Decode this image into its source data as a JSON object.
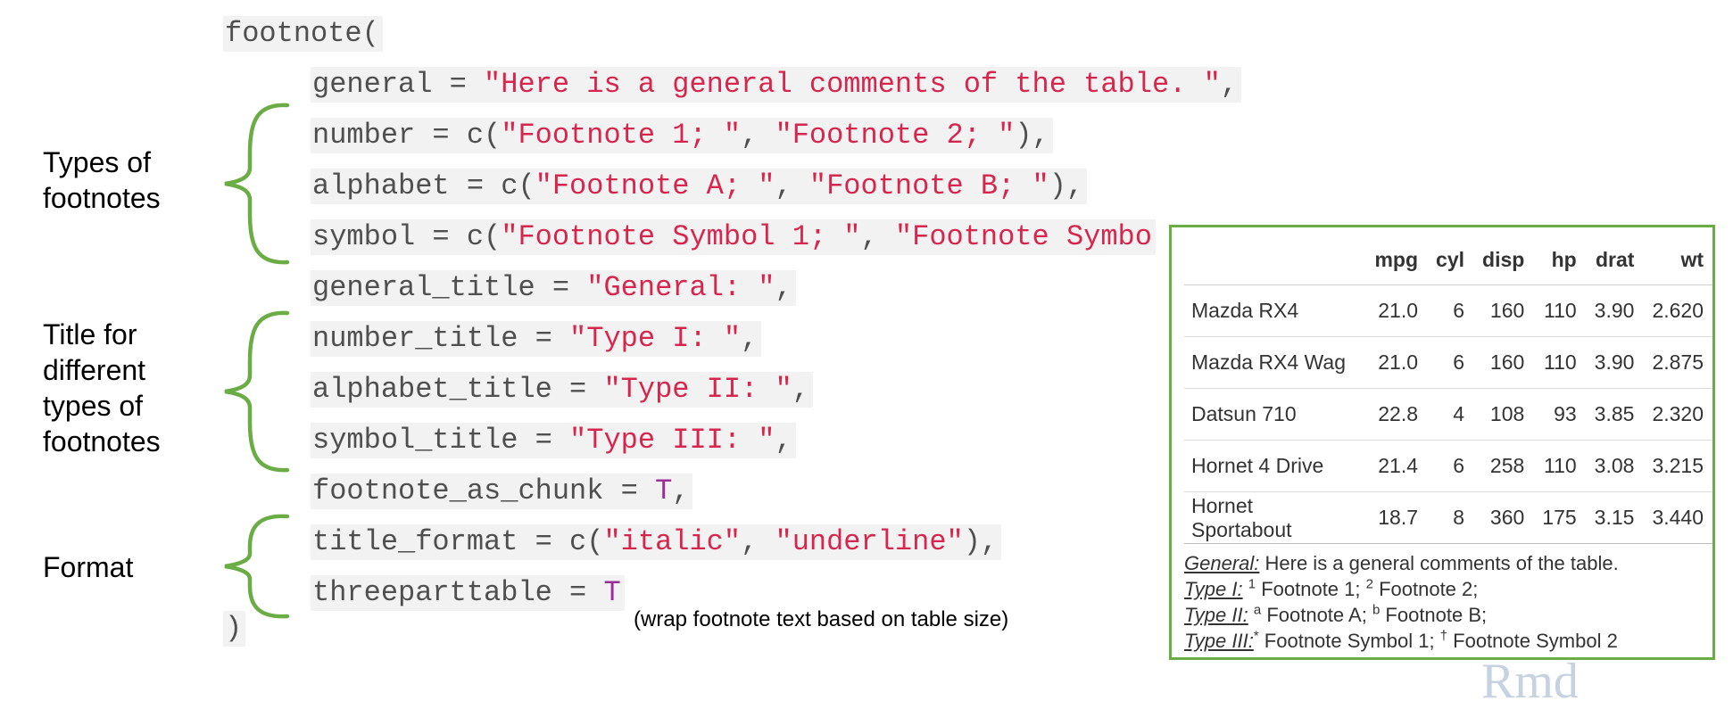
{
  "code": {
    "lines": {
      "l1": "footnote(",
      "l2_key": "general = ",
      "l2_str": "\"Here is a general comments of the table. \"",
      "l2_end": ",",
      "l3_key": "number = c(",
      "l3_s1": "\"Footnote 1; \"",
      "l3_sep": ", ",
      "l3_s2": "\"Footnote 2; \"",
      "l3_end": "),",
      "l4_key": "alphabet = c(",
      "l4_s1": "\"Footnote A; \"",
      "l4_sep": ", ",
      "l4_s2": "\"Footnote B; \"",
      "l4_end": "),",
      "l5_key": "symbol = c(",
      "l5_s1": "\"Footnote Symbol 1; \"",
      "l5_sep": ", ",
      "l5_s2": "\"Footnote Symbo",
      "l6_key": "general_title = ",
      "l6_str": "\"General: \"",
      "l6_end": ",",
      "l7_key": "number_title = ",
      "l7_str": "\"Type I: \"",
      "l7_end": ",",
      "l8_key": "alphabet_title = ",
      "l8_str": "\"Type II: \"",
      "l8_end": ",",
      "l9_key": "symbol_title = ",
      "l9_str": "\"Type III: \"",
      "l9_end": ",",
      "l10_key": "footnote_as_chunk = ",
      "l10_val": "T",
      "l10_end": ",",
      "l11_key": "title_format = c(",
      "l11_s1": "\"italic\"",
      "l11_sep": ", ",
      "l11_s2": "\"underline\"",
      "l11_end": "),",
      "l12_key": "threeparttable = ",
      "l12_val": "T",
      "l13": ")"
    }
  },
  "labels": {
    "types_line1": "Types of",
    "types_line2": "footnotes",
    "title_line1": "Title for",
    "title_line2": "different",
    "title_line3": "types of",
    "title_line4": "footnotes",
    "format": "Format",
    "wrap_note": "(wrap footnote text based on table size)"
  },
  "colors": {
    "brace": "#6aad45",
    "string": "#d7264d",
    "logical": "#9a2f9a",
    "code_bg": "#f2f2f2",
    "table_border": "#6aad45"
  },
  "table": {
    "headers": [
      "",
      "mpg",
      "cyl",
      "disp",
      "hp",
      "drat",
      "wt"
    ],
    "rows": [
      [
        "Mazda RX4",
        "21.0",
        "6",
        "160",
        "110",
        "3.90",
        "2.620"
      ],
      [
        "Mazda RX4 Wag",
        "21.0",
        "6",
        "160",
        "110",
        "3.90",
        "2.875"
      ],
      [
        "Datsun 710",
        "22.8",
        "4",
        "108",
        "93",
        "3.85",
        "2.320"
      ],
      [
        "Hornet 4 Drive",
        "21.4",
        "6",
        "258",
        "110",
        "3.08",
        "3.215"
      ],
      [
        "Hornet Sportabout",
        "18.7",
        "8",
        "360",
        "175",
        "3.15",
        "3.440"
      ]
    ],
    "footnotes": {
      "general_title": "General:",
      "general_text": " Here is a general comments of the table.",
      "type1_title": "Type I:",
      "type1_m1": "1",
      "type1_t1": " Footnote 1; ",
      "type1_m2": "2",
      "type1_t2": " Footnote 2;",
      "type2_title": "Type II:",
      "type2_m1": "a",
      "type2_t1": " Footnote A; ",
      "type2_m2": "b",
      "type2_t2": " Footnote B;",
      "type3_title": "Type III:",
      "type3_m1": "*",
      "type3_t1": " Footnote Symbol 1; ",
      "type3_m2": "†",
      "type3_t2": " Footnote Symbol 2"
    }
  }
}
